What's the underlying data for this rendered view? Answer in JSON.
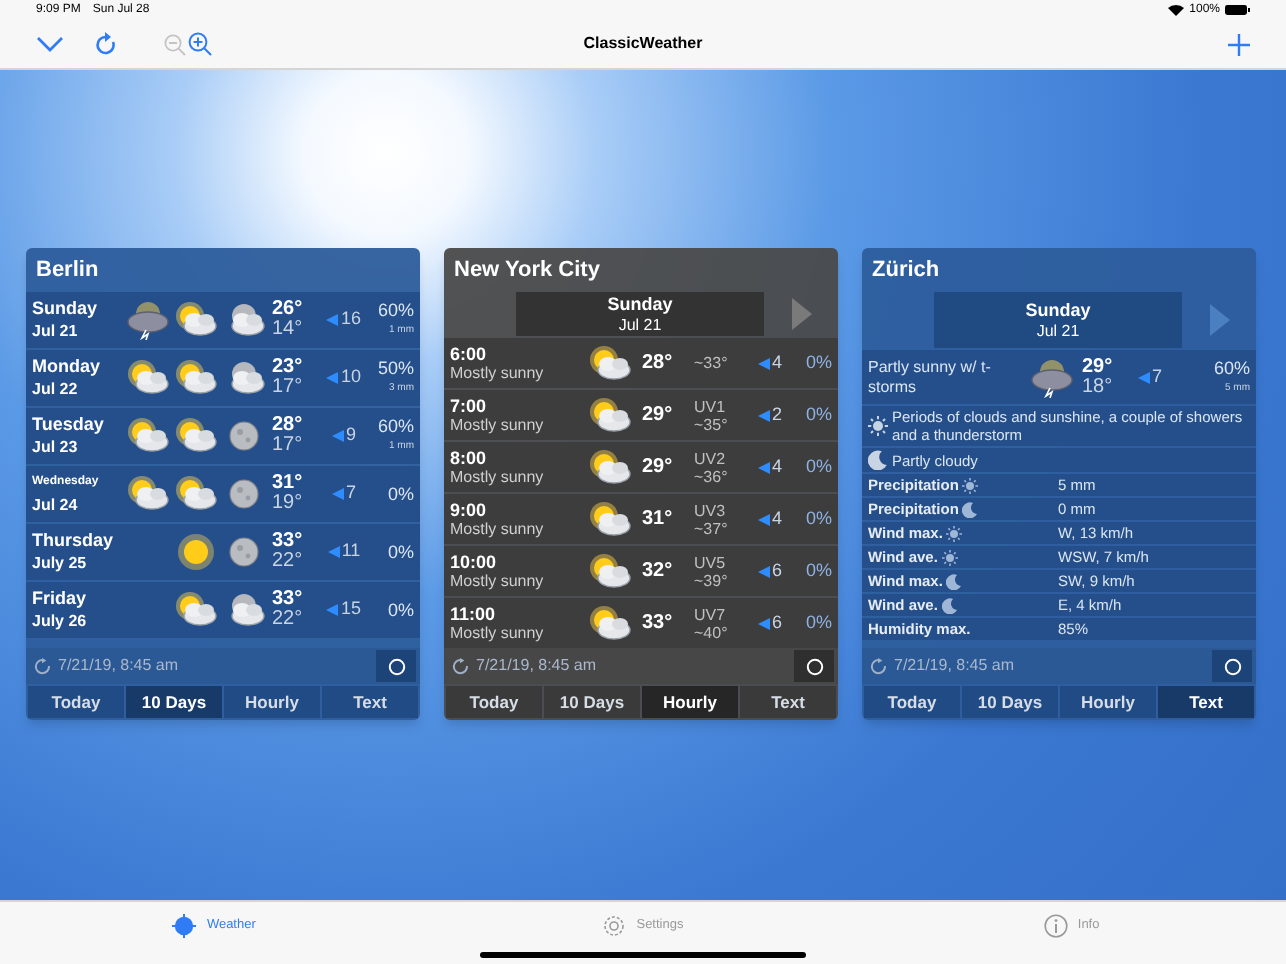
{
  "status_bar": {
    "time": "9:09 PM",
    "date": "Sun Jul 28",
    "battery": "100%"
  },
  "nav": {
    "title": "ClassicWeather",
    "zoom_out_disabled": true
  },
  "cards": [
    {
      "kind": "days",
      "city": "Berlin",
      "rows": [
        {
          "day": "Sunday",
          "date": "Jul 21",
          "icons": [
            {
              "kind": "storm"
            },
            {
              "kind": "partly"
            },
            {
              "kind": "cloud-moon"
            }
          ],
          "high": "26°",
          "low": "14°",
          "wind": "16",
          "precip": "60%",
          "amount": "1 mm"
        },
        {
          "day": "Monday",
          "date": "Jul 22",
          "icons": [
            {
              "kind": "partly"
            },
            {
              "kind": "partly"
            },
            {
              "kind": "cloud-moon"
            }
          ],
          "high": "23°",
          "low": "17°",
          "wind": "10",
          "precip": "50%",
          "amount": "3 mm"
        },
        {
          "day": "Tuesday",
          "date": "Jul 23",
          "icons": [
            {
              "kind": "partly"
            },
            {
              "kind": "partly"
            },
            {
              "kind": "moon"
            }
          ],
          "high": "28°",
          "low": "17°",
          "wind": "9",
          "precip": "60%",
          "amount": "1 mm"
        },
        {
          "day": "Wednesday",
          "date": "Jul 24",
          "icons": [
            {
              "kind": "partly"
            },
            {
              "kind": "partly"
            },
            {
              "kind": "moon"
            }
          ],
          "high": "31°",
          "low": "19°",
          "wind": "7",
          "precip": "0%"
        },
        {
          "day": "Thursday",
          "date": "July 25",
          "icons": [
            {
              "kind": "none"
            },
            {
              "kind": "sun"
            },
            {
              "kind": "moon"
            }
          ],
          "high": "33°",
          "low": "22°",
          "wind": "11",
          "precip": "0%"
        },
        {
          "day": "Friday",
          "date": "July 26",
          "icons": [
            {
              "kind": "none"
            },
            {
              "kind": "partly"
            },
            {
              "kind": "cloud-moon"
            }
          ],
          "high": "33°",
          "low": "22°",
          "wind": "15",
          "precip": "0%"
        }
      ],
      "updated": "7/21/19, 8:45 am",
      "tabs": [
        {
          "label": "Today",
          "selected": false
        },
        {
          "label": "10 Days",
          "selected": true
        },
        {
          "label": "Hourly",
          "selected": false
        },
        {
          "label": "Text",
          "selected": false
        }
      ]
    },
    {
      "kind": "hourly",
      "city": "New York City",
      "day": "Sunday",
      "date": "Jul 21",
      "rows": [
        {
          "time": "6:00",
          "condition": "Mostly sunny",
          "temp": "28°",
          "feels": "~33°",
          "wind": "4",
          "precip": "0%"
        },
        {
          "time": "7:00",
          "condition": "Mostly sunny",
          "temp": "29°",
          "uv": "UV1",
          "feels": "~35°",
          "wind": "2",
          "precip": "0%"
        },
        {
          "time": "8:00",
          "condition": "Mostly sunny",
          "temp": "29°",
          "uv": "UV2",
          "feels": "~36°",
          "wind": "4",
          "precip": "0%"
        },
        {
          "time": "9:00",
          "condition": "Mostly sunny",
          "temp": "31°",
          "uv": "UV3",
          "feels": "~37°",
          "wind": "4",
          "precip": "0%"
        },
        {
          "time": "10:00",
          "condition": "Mostly sunny",
          "temp": "32°",
          "uv": "UV5",
          "feels": "~39°",
          "wind": "6",
          "precip": "0%"
        },
        {
          "time": "11:00",
          "condition": "Mostly sunny",
          "temp": "33°",
          "uv": "UV7",
          "feels": "~40°",
          "wind": "6",
          "precip": "0%"
        }
      ],
      "updated": "7/21/19, 8:45 am",
      "tabs": [
        {
          "label": "Today",
          "selected": false
        },
        {
          "label": "10 Days",
          "selected": false
        },
        {
          "label": "Hourly",
          "selected": true
        },
        {
          "label": "Text",
          "selected": false
        }
      ]
    },
    {
      "kind": "text",
      "city": "Zürich",
      "day": "Sunday",
      "date": "Jul 21",
      "summary": {
        "condition": "Partly sunny w/ t-storms",
        "high": "29°",
        "low": "18°",
        "wind": "7",
        "precip": "60%",
        "amount": "5 mm"
      },
      "notes": [
        {
          "kind": "day",
          "text": "Periods of clouds and sunshine, a couple of showers and a thunderstorm"
        },
        {
          "kind": "night",
          "text": "Partly cloudy"
        }
      ],
      "details": [
        {
          "label": "Precipitation",
          "kind": "day",
          "value": "5 mm"
        },
        {
          "label": "Precipitation",
          "kind": "night",
          "value": "0 mm"
        },
        {
          "label": "Wind max.",
          "kind": "day",
          "value": "W, 13 km/h"
        },
        {
          "label": "Wind ave.",
          "kind": "day",
          "value": "WSW, 7 km/h"
        },
        {
          "label": "Wind max.",
          "kind": "night",
          "value": "SW, 9 km/h"
        },
        {
          "label": "Wind ave.",
          "kind": "night",
          "value": "E, 4 km/h"
        },
        {
          "label": "Humidity max.",
          "value": "85%"
        }
      ],
      "updated": "7/21/19, 8:45 am",
      "tabs": [
        {
          "label": "Today",
          "selected": false
        },
        {
          "label": "10 Days",
          "selected": false
        },
        {
          "label": "Hourly",
          "selected": false
        },
        {
          "label": "Text",
          "selected": true
        }
      ]
    }
  ],
  "tab_bar": [
    {
      "label": "Weather",
      "selected": true
    },
    {
      "label": "Settings",
      "selected": false
    },
    {
      "label": "Info",
      "selected": false
    }
  ]
}
